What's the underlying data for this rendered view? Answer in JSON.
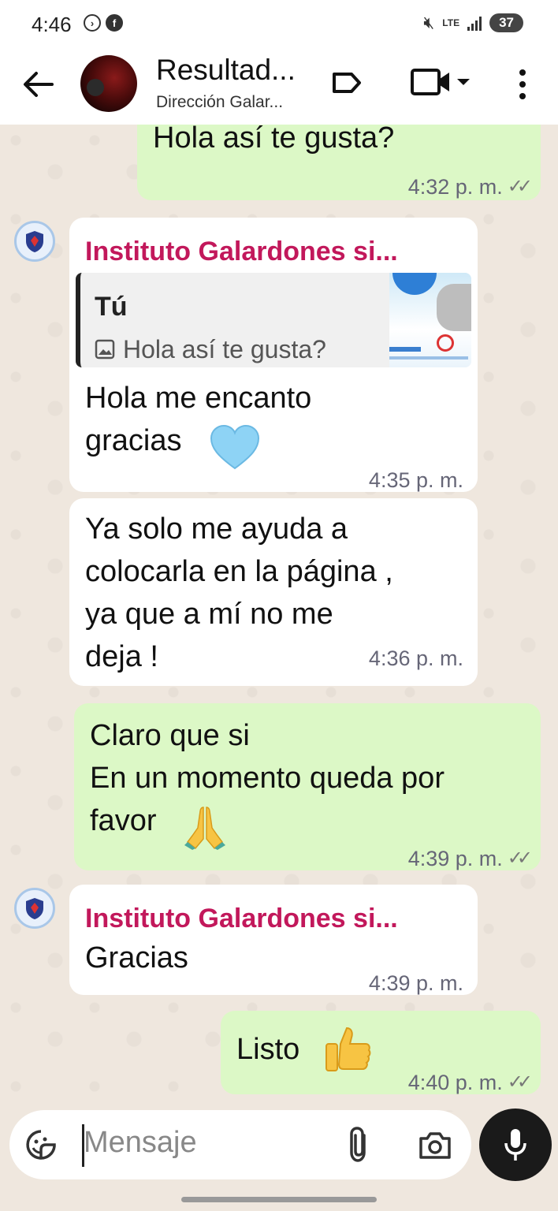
{
  "status_bar": {
    "time": "4:46",
    "network": "LTE",
    "battery": "37"
  },
  "header": {
    "title": "Resultad...",
    "subtitle": "Dirección Galar..."
  },
  "messages": [
    {
      "type": "outgoing",
      "text": "Hola así te gusta?",
      "time": "4:32 p. m.",
      "status": "read"
    },
    {
      "type": "incoming",
      "sender": "Instituto Galardones si...",
      "reply": {
        "author": "Tú",
        "text": "Hola así te gusta?"
      },
      "text": "Hola me encanto\ngracias",
      "emoji": "light-blue-heart",
      "time": "4:35 p. m."
    },
    {
      "type": "incoming",
      "text": "Ya solo me ayuda a\ncolocarla en la página ,\nya que a mí no me\ndeja !",
      "time": "4:36 p. m."
    },
    {
      "type": "outgoing",
      "text": "Claro que si\nEn un momento queda por\nfavor",
      "emoji": "folded-hands",
      "time": "4:39 p. m.",
      "status": "read"
    },
    {
      "type": "incoming",
      "sender": "Instituto Galardones si...",
      "text": "Gracias",
      "time": "4:39 p. m."
    },
    {
      "type": "outgoing",
      "text": "Listo",
      "emoji": "thumbs-up",
      "time": "4:40 p. m.",
      "status": "read"
    }
  ],
  "input": {
    "placeholder": "Mensaje"
  },
  "colors": {
    "outgoing_bubble": "#dcf8c6",
    "incoming_bubble": "#ffffff",
    "sender_name": "#c2185b",
    "chat_background": "#efe7de"
  }
}
